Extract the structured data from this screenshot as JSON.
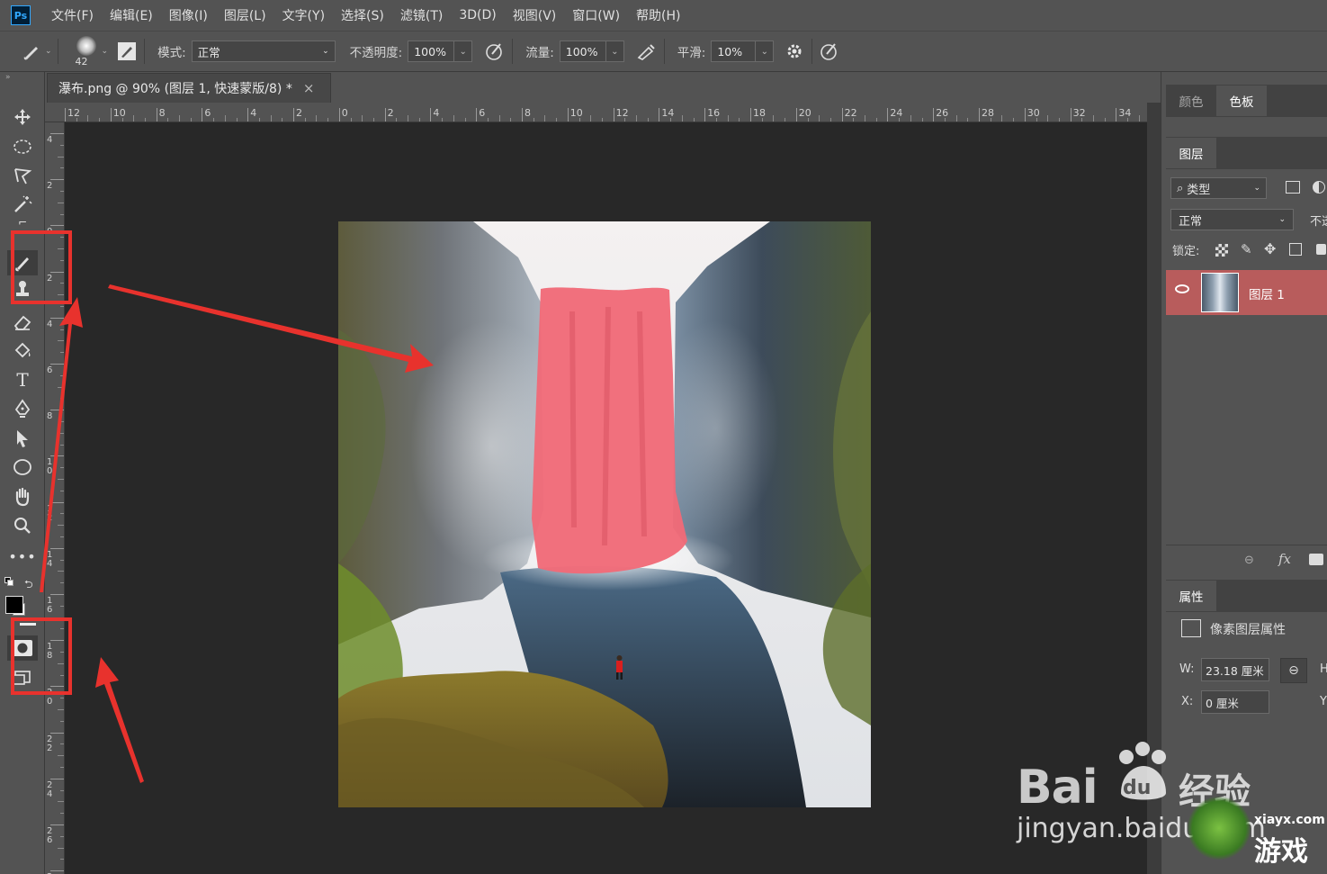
{
  "app": {
    "logo": "Ps"
  },
  "menu": [
    "文件(F)",
    "编辑(E)",
    "图像(I)",
    "图层(L)",
    "文字(Y)",
    "选择(S)",
    "滤镜(T)",
    "3D(D)",
    "视图(V)",
    "窗口(W)",
    "帮助(H)"
  ],
  "options": {
    "brush_size": "42",
    "mode_label": "模式:",
    "mode_value": "正常",
    "opacity_label": "不透明度:",
    "opacity_value": "100%",
    "flow_label": "流量:",
    "flow_value": "100%",
    "smoothing_label": "平滑:",
    "smoothing_value": "10%"
  },
  "document": {
    "tab_title": "瀑布.png @ 90% (图层 1, 快速蒙版/8) *",
    "close_glyph": "×",
    "ruler_h": [
      "12",
      "10",
      "8",
      "6",
      "4",
      "2",
      "0",
      "2",
      "4",
      "6",
      "8",
      "10",
      "12",
      "14",
      "16",
      "18",
      "20",
      "22",
      "24",
      "26",
      "28",
      "30",
      "32",
      "34"
    ],
    "ruler_v": [
      "4",
      "2",
      "0",
      "2",
      "4",
      "6",
      "8",
      "1 0",
      "1 2",
      "1 4",
      "1 6",
      "1 8",
      "2 0",
      "2 2",
      "2 4",
      "2 6",
      "2"
    ]
  },
  "panels": {
    "top_tabs": [
      "颜色",
      "色板"
    ],
    "layers_tab": "图层",
    "filter_kind": "类型",
    "blend_mode": "正常",
    "opacity_cut": "不透",
    "lock_label": "锁定:",
    "layer_name": "图层 1",
    "fx_label": "fx",
    "properties_tab": "属性",
    "properties_type": "像素图层属性",
    "w_label": "W:",
    "w_value": "23.18 厘米",
    "x_label": "X:",
    "x_value": "0 厘米",
    "h_cut": "H",
    "y_cut": "Y"
  },
  "watermark": {
    "baidu_text": "Bai",
    "baidu_du": "du",
    "jingyan": "经验",
    "url": "jingyan.baidu.com",
    "site": "xiayx.com",
    "game": "游戏"
  },
  "colors": {
    "accent_red": "#e8322d",
    "mask_overlay": "#f06a78",
    "layer_selected": "#b85c5c"
  }
}
